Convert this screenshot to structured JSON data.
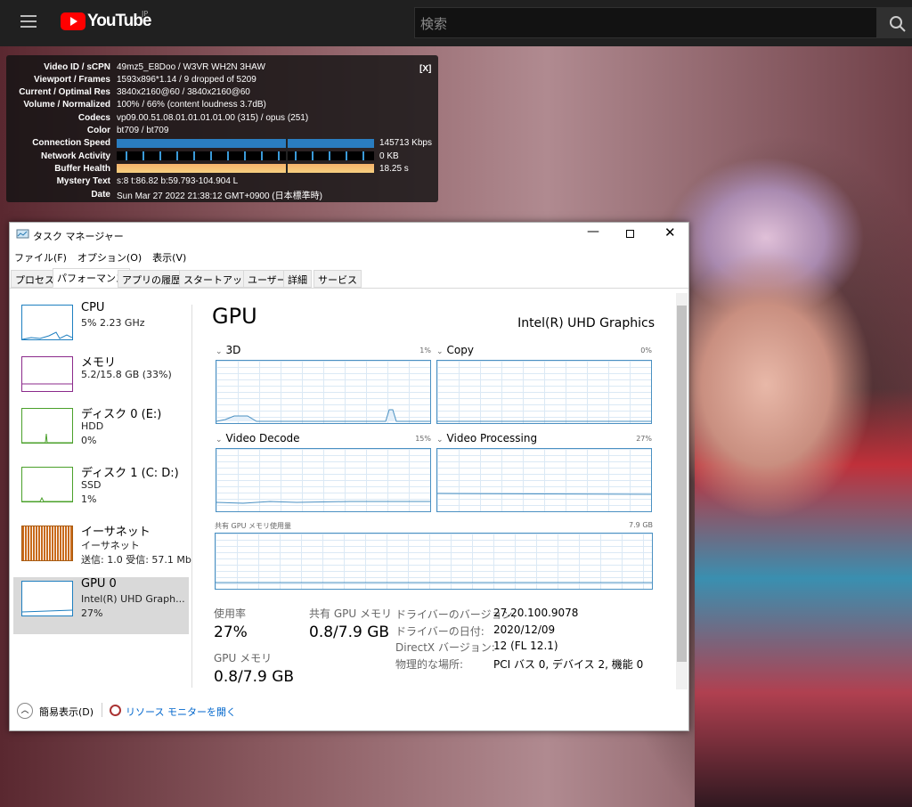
{
  "youtube": {
    "logo_text": "YouTube",
    "region": "JP",
    "search_placeholder": "検索"
  },
  "stats": {
    "close": "[X]",
    "rows": [
      {
        "label": "Video ID / sCPN",
        "value": "49mz5_E8Doo  /  W3VR  WH2N  3HAW"
      },
      {
        "label": "Viewport / Frames",
        "value": "1593x896*1.14 / 9 dropped of 5209"
      },
      {
        "label": "Current / Optimal Res",
        "value": "3840x2160@60 / 3840x2160@60"
      },
      {
        "label": "Volume / Normalized",
        "value": "100% / 66% (content loudness 3.7dB)"
      },
      {
        "label": "Codecs",
        "value": "vp09.00.51.08.01.01.01.01.00 (315) / opus (251)"
      },
      {
        "label": "Color",
        "value": "bt709 / bt709"
      },
      {
        "label": "Connection Speed",
        "value": "145713 Kbps"
      },
      {
        "label": "Network Activity",
        "value": "0 KB"
      },
      {
        "label": "Buffer Health",
        "value": "18.25 s"
      },
      {
        "label": "Mystery Text",
        "value": "s:8 t:86.82 b:59.793-104.904 L"
      },
      {
        "label": "Date",
        "value": "Sun Mar 27 2022 21:38:12 GMT+0900 (日本標準時)"
      }
    ]
  },
  "taskmanager": {
    "title": "タスク マネージャー",
    "menu": [
      "ファイル(F)",
      "オプション(O)",
      "表示(V)"
    ],
    "tabs": [
      "プロセス",
      "パフォーマンス",
      "アプリの履歴",
      "スタートアップ",
      "ユーザー",
      "詳細",
      "サービス"
    ],
    "sidebar": [
      {
        "name": "CPU",
        "l1": "5% 2.23 GHz",
        "l2": ""
      },
      {
        "name": "メモリ",
        "l1": "5.2/15.8 GB (33%)",
        "l2": ""
      },
      {
        "name": "ディスク 0 (E:)",
        "l1": "HDD",
        "l2": "0%"
      },
      {
        "name": "ディスク 1 (C: D:)",
        "l1": "SSD",
        "l2": "1%"
      },
      {
        "name": "イーサネット",
        "l1": "イーサネット",
        "l2": "送信: 1.0  受信: 57.1 Mb"
      },
      {
        "name": "GPU 0",
        "l1": "Intel(R) UHD Graph...",
        "l2": "27%"
      }
    ],
    "main": {
      "title": "GPU",
      "device": "Intel(R) UHD Graphics",
      "graphs": [
        {
          "label": "3D",
          "pct": "1%"
        },
        {
          "label": "Copy",
          "pct": "0%"
        },
        {
          "label": "Video Decode",
          "pct": "15%"
        },
        {
          "label": "Video Processing",
          "pct": "27%"
        }
      ],
      "shared_label": "共有 GPU メモリ使用量",
      "shared_max": "7.9 GB",
      "usage_label": "使用率",
      "usage": "27%",
      "shared_mem_label": "共有 GPU メモリ",
      "shared_mem": "0.8/7.9 GB",
      "gpu_mem_label": "GPU メモリ",
      "gpu_mem": "0.8/7.9 GB",
      "info": [
        [
          "ドライバーのバージョン:",
          "27.20.100.9078"
        ],
        [
          "ドライバーの日付:",
          "2020/12/09"
        ],
        [
          "DirectX バージョン:",
          "12 (FL 12.1)"
        ],
        [
          "物理的な場所:",
          "PCI バス 0, デバイス 2, 機能 0"
        ]
      ]
    },
    "footer": {
      "simple": "簡易表示(D)",
      "resmon": "リソース モニターを開く"
    }
  },
  "colors": {
    "gpu": "#4a90c2",
    "selected": "#d9d9d9",
    "link": "#0066cc"
  }
}
